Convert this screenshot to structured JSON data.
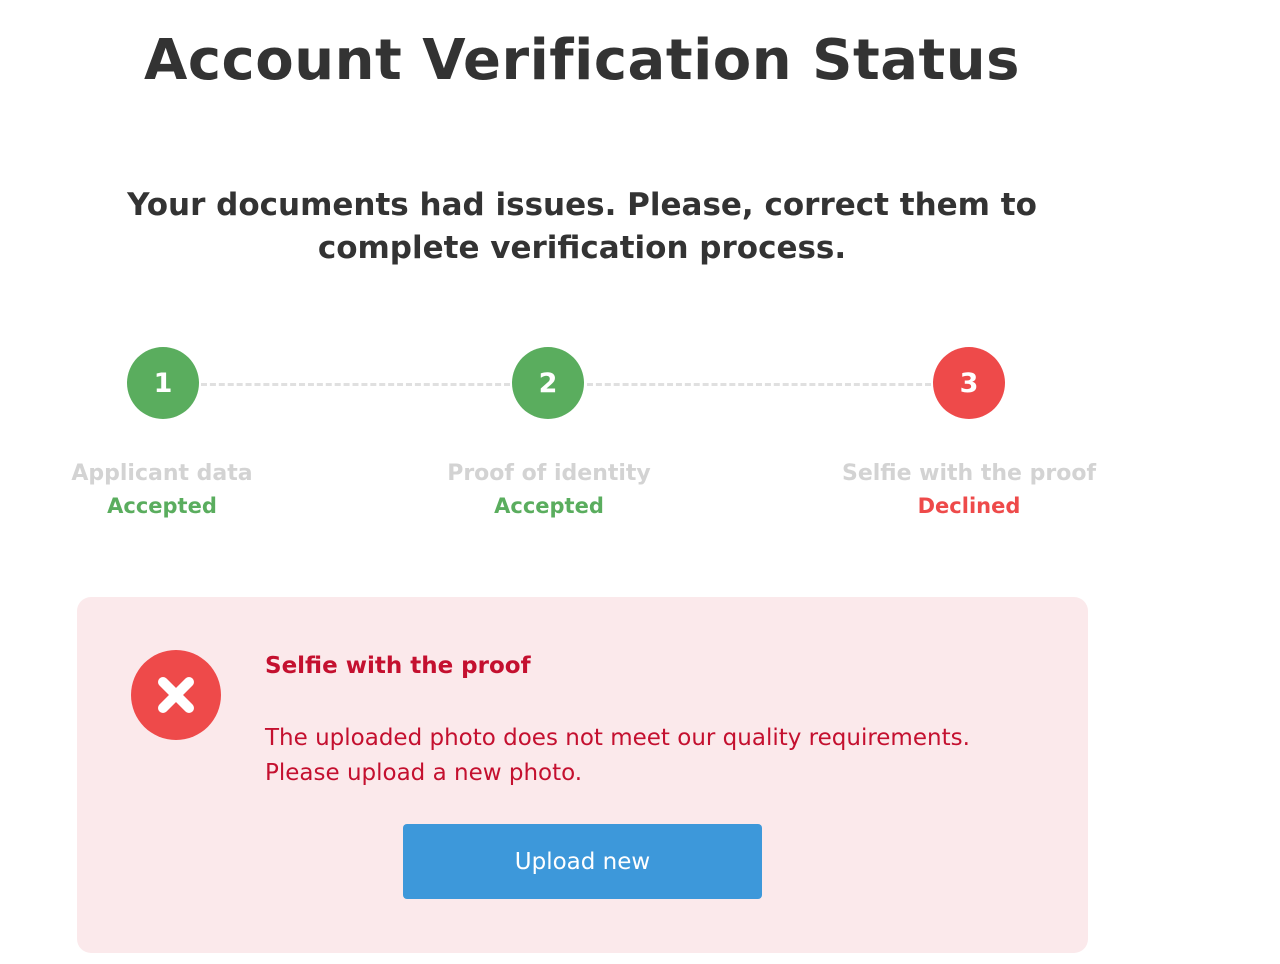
{
  "page_title": "Account Verification Status",
  "subtitle": "Your documents had issues. Please, correct them to complete verification process.",
  "steps": [
    {
      "number": "1",
      "label": "Applicant data",
      "status": "Accepted",
      "state": "accepted"
    },
    {
      "number": "2",
      "label": "Proof of identity",
      "status": "Accepted",
      "state": "accepted"
    },
    {
      "number": "3",
      "label": "Selfie with the proof",
      "status": "Declined",
      "state": "declined"
    }
  ],
  "error_panel": {
    "title": "Selfie with the proof",
    "message_line1": "The uploaded photo does not meet our quality requirements.",
    "message_line2": "Please upload a new photo.",
    "icon": "close-icon",
    "upload_label": "Upload new"
  },
  "colors": {
    "accepted": "#5aad5e",
    "declined": "#ee4a4a",
    "error_text": "#c4102f",
    "error_bg": "#fbe9eb",
    "button": "#3d98da",
    "muted_label": "#d3d3d3",
    "heading": "#333333"
  }
}
